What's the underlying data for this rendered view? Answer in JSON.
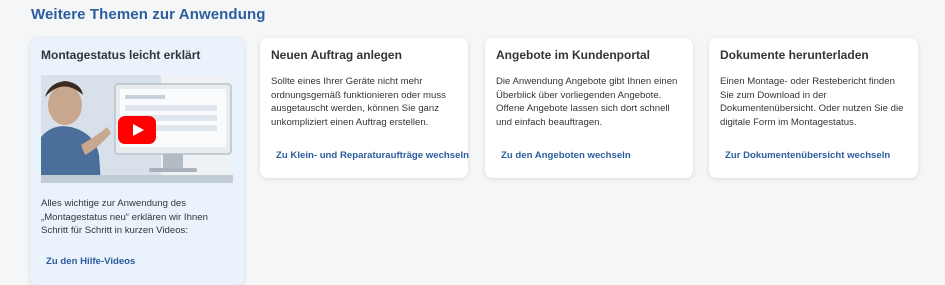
{
  "section": {
    "title": "Weitere Themen zur Anwendung"
  },
  "cards": [
    {
      "title": "Montagestatus leicht erklärt",
      "text": "Alles wichtige zur Anwendung des „Montagestatus neu“ erklären wir Ihnen Schritt für Schritt in kurzen Videos:",
      "link": "Zu den Hilfe-Videos",
      "media": {
        "icon": "play-icon",
        "accent": "#ff0000"
      }
    },
    {
      "title": "Neuen Auftrag anlegen",
      "text": "Sollte eines Ihrer Geräte nicht mehr ordnungsgemäß funktionieren oder muss ausgetauscht werden, können Sie ganz unkompliziert einen Auftrag erstellen.",
      "link": "Zu Klein- und Reparaturaufträge wechseln"
    },
    {
      "title": "Angebote im Kundenportal",
      "text": "Die Anwendung Angebote gibt Ihnen einen Überblick über vorliegenden Angebote. Offene Angebote lassen sich dort schnell und einfach beauftragen.",
      "link": "Zu den Angeboten wechseln"
    },
    {
      "title": "Dokumente herunterladen",
      "text": "Einen Montage- oder Restebericht finden Sie zum Download in der Dokumentenübersicht. Oder nutzen Sie die digitale Form im Montagestatus.",
      "link": "Zur Dokumentenübersicht wechseln"
    }
  ],
  "colors": {
    "title": "#2c5d9e",
    "link": "#2c5d9e",
    "highlight_card": "#eaf2fb",
    "card": "#ffffff",
    "background": "#f5f6f7"
  }
}
